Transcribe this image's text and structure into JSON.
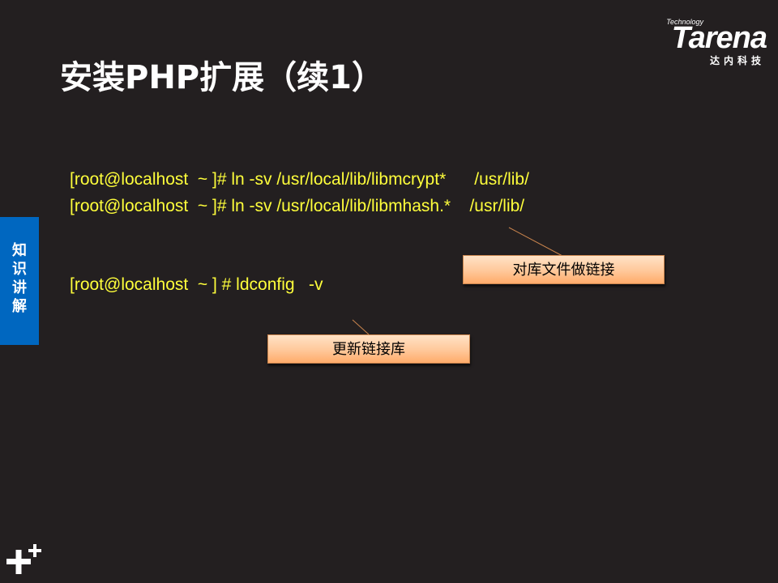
{
  "title": "安装PHP扩展（续1）",
  "logo": {
    "small": "Technology",
    "main": "Tarena",
    "cn": "达内科技"
  },
  "side_tab": {
    "label": "知识讲解"
  },
  "commands": [
    "[root@localhost  ~ ]# ln -sv /usr/local/lib/libmcrypt*      /usr/lib/",
    "[root@localhost  ~ ]# ln -sv /usr/local/lib/libmhash.*    /usr/lib/",
    "[root@localhost  ~ ] # ldconfig   -v"
  ],
  "callouts": {
    "link": "对库文件做链接",
    "update": "更新链接库"
  },
  "colors": {
    "background": "#231f20",
    "command_text": "#ffff3b",
    "side_tab": "#0067c0",
    "callout_fill": "#ffc89a",
    "connector": "#c9844d"
  },
  "icons": {
    "corner_logo": "plus-plus-icon"
  }
}
